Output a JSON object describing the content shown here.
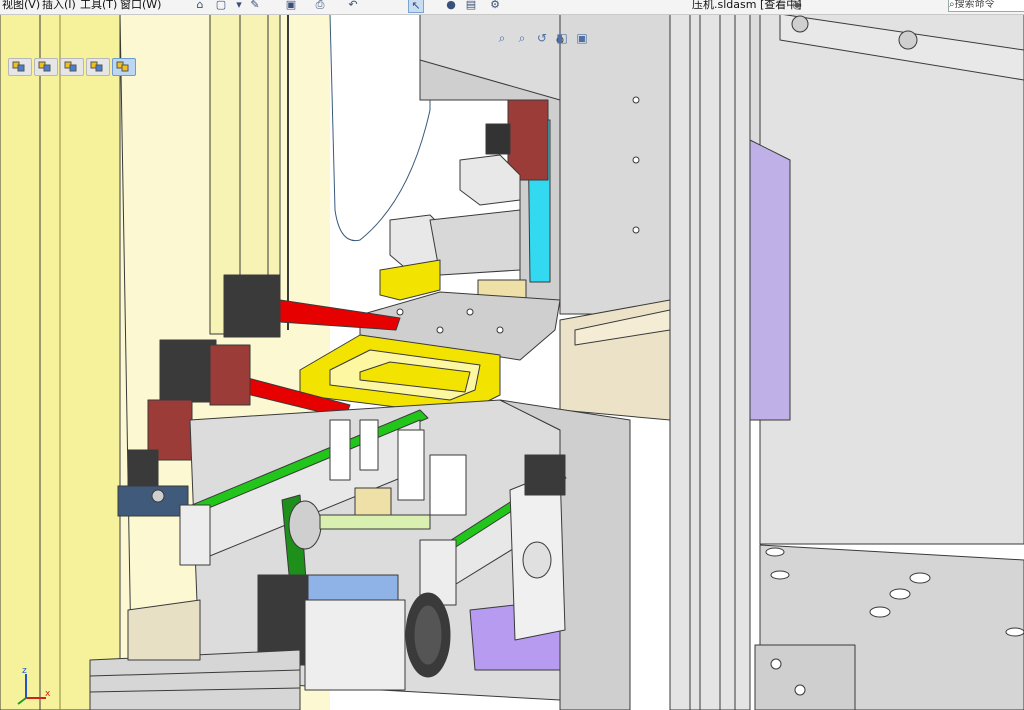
{
  "menu": [
    "视图(V)",
    "插入(I)",
    "工具(T)",
    "窗口(W)"
  ],
  "toolbar_icons": [
    "home-icon",
    "new-document-icon",
    "options-dropdown-icon",
    "save-icon",
    "print-icon",
    "undo-icon",
    "select-cursor-icon",
    "rebuild-icon",
    "file-properties-icon",
    "settings-icon"
  ],
  "document_title": "压机.sldasm [查看中]",
  "search": {
    "placeholder": "搜索命令"
  },
  "breadcrumb_icons": [
    "assembly-icon",
    "assembly-icon",
    "assembly-icon",
    "assembly-icon",
    "assembly-icon"
  ],
  "heads_up_icons": [
    "zoom-to-fit-icon",
    "zoom-area-icon",
    "previous-view-icon",
    "section-view-icon",
    "view-orientation-icon"
  ],
  "triad": {
    "label_x": "x",
    "label_z": "z"
  },
  "colors": {
    "frame_gray": "#d3d3d3",
    "frame_edge": "#3a3a3a",
    "slot_yellow": "#f6f19b",
    "part_yellow": "#f2e300",
    "cone_red": "#e60000",
    "guide_green": "#22c51a",
    "slider_cyan": "#33d9f0",
    "motor_dark": "#3a3a3a",
    "bracket_red": "#9c3c38",
    "plate_blue": "#8fb3e6",
    "purple_part": "#b79bf0"
  }
}
